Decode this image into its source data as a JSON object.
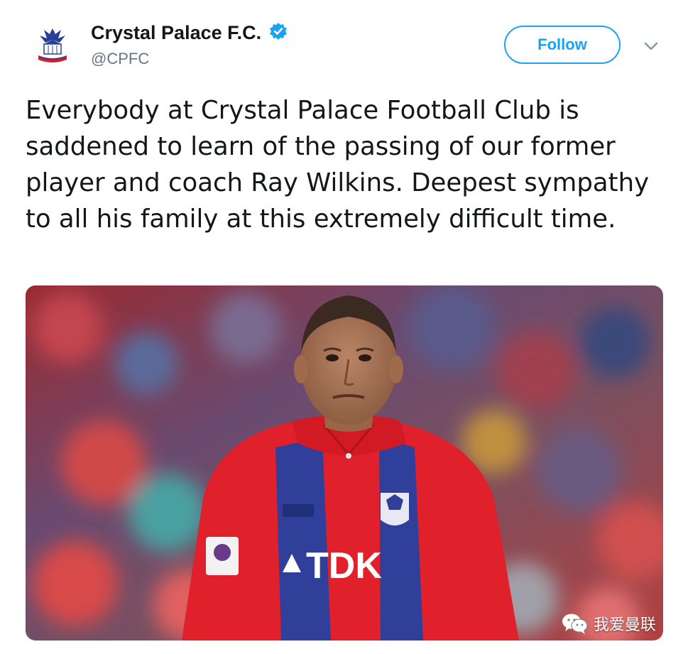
{
  "tweet": {
    "author": {
      "display_name": "Crystal Palace F.C.",
      "handle": "@CPFC",
      "verified": true,
      "avatar_icon": "crystal-palace-crest-icon"
    },
    "follow_label": "Follow",
    "menu_icon": "chevron-down-icon",
    "text": "Everybody at Crystal Palace Football Club is saddened to learn of the passing of our former player and coach Ray Wilkins. Deepest sympathy to all his family at this extremely difficult time.",
    "media": {
      "kind": "photo",
      "shirt_sponsor": "TDK"
    }
  },
  "watermark": {
    "text": "我爱曼联",
    "icon": "wechat-icon"
  },
  "colors": {
    "accent": "#1da1f2",
    "text": "#14171a",
    "muted": "#657786",
    "shirt_red": "#e0202a",
    "shirt_blue": "#2f3f9a"
  }
}
